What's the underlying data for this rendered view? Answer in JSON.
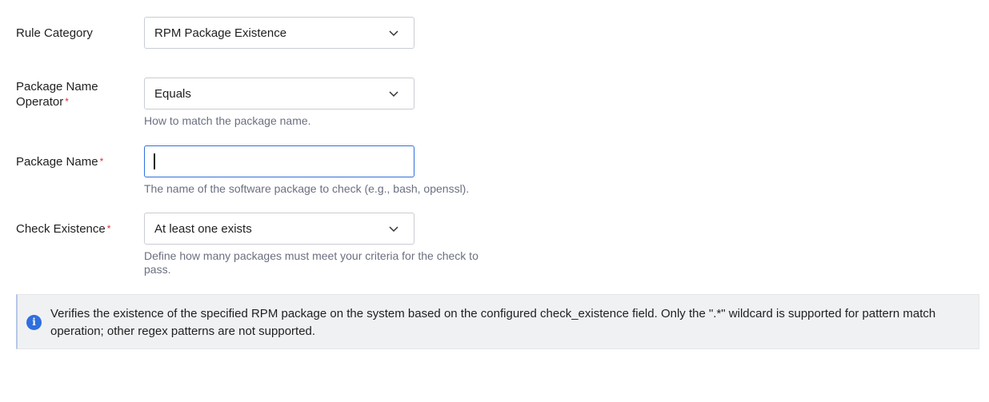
{
  "rule_category": {
    "label": "Rule Category",
    "value": "RPM Package Existence"
  },
  "package_name_operator": {
    "label_line1": "Package Name",
    "label_line2": "Operator",
    "required": "*",
    "value": "Equals",
    "help": "How to match the package name."
  },
  "package_name": {
    "label": "Package Name",
    "required": "*",
    "value": "",
    "help": "The name of the software package to check (e.g., bash, openssl)."
  },
  "check_existence": {
    "label": "Check Existence",
    "required": "*",
    "value": "At least one exists",
    "help": "Define how many packages must meet your criteria for the check to pass."
  },
  "info": {
    "icon": "info-icon",
    "glyph": "i",
    "text": "Verifies the existence of the specified RPM package on the system based on the configured check_existence field. Only the \".*\" wildcard is supported for pattern match operation; other regex patterns are not supported."
  },
  "colors": {
    "accent": "#2f6fde",
    "required": "#d92f2f",
    "help_text": "#6b7080",
    "info_bg": "#f0f1f3"
  }
}
